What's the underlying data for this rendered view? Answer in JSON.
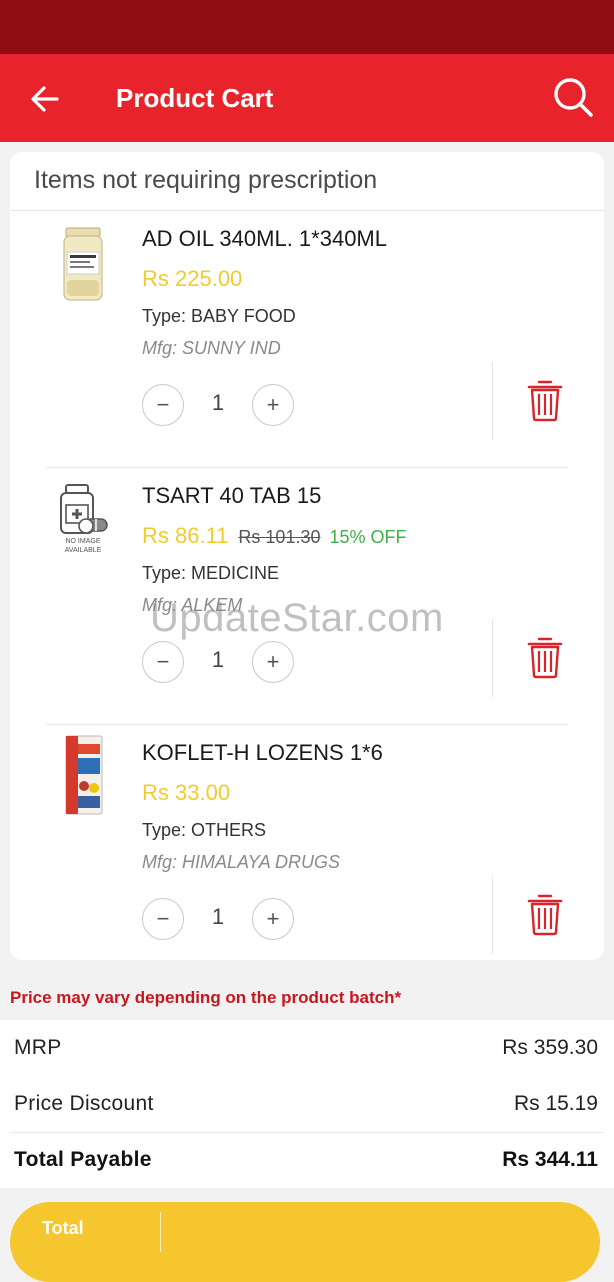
{
  "header": {
    "title": "Product Cart"
  },
  "section": {
    "title": "Items not requiring prescription"
  },
  "items": [
    {
      "name": "AD OIL 340ML. 1*340ML",
      "price": "Rs 225.00",
      "mrp": "",
      "discount": "",
      "type": "Type: BABY FOOD",
      "mfg": "Mfg: SUNNY IND",
      "qty": "1"
    },
    {
      "name": "TSART 40 TAB 15",
      "price": "Rs 86.11",
      "mrp": "Rs 101.30",
      "discount": "15% OFF",
      "type": "Type: MEDICINE",
      "mfg": "Mfg: ALKEM",
      "qty": "1",
      "no_image_text": [
        "NO IMAGE",
        "AVAILABLE"
      ]
    },
    {
      "name": "KOFLET-H LOZENS 1*6",
      "price": "Rs 33.00",
      "mrp": "",
      "discount": "",
      "type": "Type: OTHERS",
      "mfg": "Mfg: HIMALAYA DRUGS",
      "qty": "1"
    }
  ],
  "stepper": {
    "minus": "−",
    "plus": "+"
  },
  "note": "Price may vary depending on the product batch*",
  "summary": {
    "mrp_label": "MRP",
    "mrp_value": "Rs 359.30",
    "discount_label": "Price Discount",
    "discount_value": "Rs 15.19",
    "total_label": "Total Payable",
    "total_value": "Rs 344.11"
  },
  "bottom_bar": {
    "label": "Total"
  },
  "watermark": "UpdateStar.com",
  "icons": {
    "back": "arrow-left-icon",
    "search": "search-icon",
    "delete": "trash-icon",
    "no_image": "medicine-bottle-icon"
  },
  "colors": {
    "status_bar": "#8f0e12",
    "app_bar": "#e9232b",
    "price": "#f0cc2d",
    "discount": "#3bb24a",
    "delete_icon": "#d8242b",
    "note": "#c8161d",
    "bottom_bar": "#f6c62f"
  }
}
